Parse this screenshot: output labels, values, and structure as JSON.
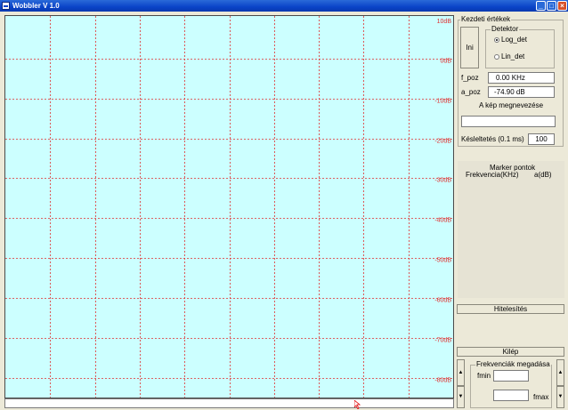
{
  "window": {
    "title": "Wobbler V 1.0",
    "min_icon": "minimize-icon",
    "max_icon": "maximize-icon",
    "close_icon": "close-icon"
  },
  "plot": {
    "background": "#ccffff",
    "grid_color": "#e03030",
    "db_labels": [
      "10dB",
      "0dB",
      "-10dB",
      "-20dB",
      "-30dB",
      "-40dB",
      "-50dB",
      "-60dB",
      "-70dB",
      "-80dB"
    ]
  },
  "kezdeti": {
    "group_label": "Kezdeti értékek",
    "ini_button": "Ini",
    "detektor_label": "Detektor",
    "log_det": "Log_det",
    "lin_det": "Lin_det",
    "selected_detector": "Log_det",
    "f_poz_label": "f_poz",
    "f_poz_value": "0.00  KHz",
    "a_poz_label": "a_poz",
    "a_poz_value": "-74.90  dB",
    "kep_label": "A kép megnevezése",
    "kep_value": "",
    "kesleltetes_label": "Késleltetés (0.1 ms)",
    "kesleltetes_value": "100"
  },
  "marker": {
    "title": "Marker pontok",
    "col_freq": "Frekvencia(KHz)",
    "col_db": "a(dB)"
  },
  "hitelesites_button": "Hitelesítés",
  "kilep_button": "Kilép",
  "frekvenciak": {
    "group_label": "Frekvenciák megadása",
    "fmin_label": "fmin",
    "fmin_value": "",
    "fmax_label": "fmax",
    "fmax_value": ""
  }
}
